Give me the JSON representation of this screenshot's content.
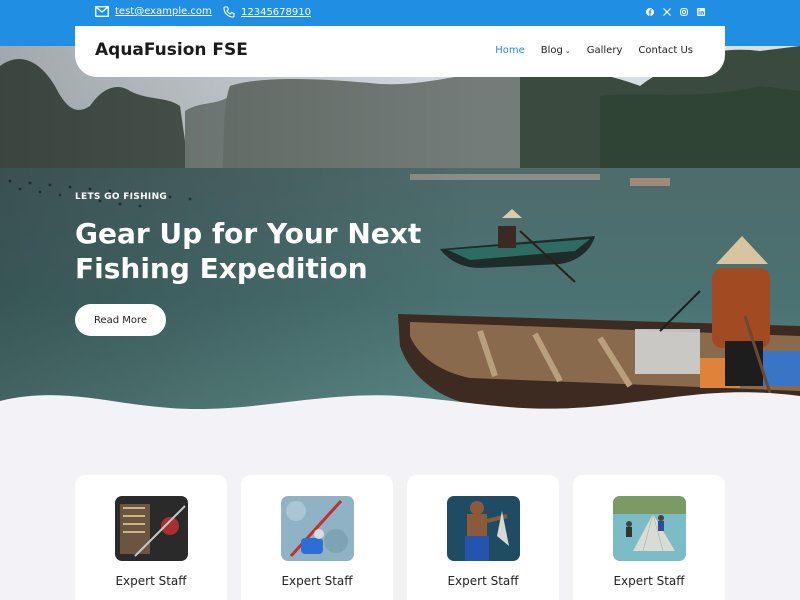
{
  "topbar": {
    "email": "test@example.com",
    "phone": "12345678910",
    "social_icons": [
      "facebook-icon",
      "x-icon",
      "instagram-icon",
      "linkedin-icon"
    ]
  },
  "header": {
    "logo": "AquaFusion FSE",
    "nav": [
      {
        "label": "Home",
        "active": true
      },
      {
        "label": "Blog",
        "dropdown": true
      },
      {
        "label": "Gallery"
      },
      {
        "label": "Contact Us"
      }
    ]
  },
  "hero": {
    "kicker": "LETS GO FISHING",
    "title": "Gear Up for Your Next Fishing Expedition",
    "button_label": "Read More"
  },
  "cards": [
    {
      "title": "Expert Staff"
    },
    {
      "title": "Expert Staff"
    },
    {
      "title": "Expert Staff"
    },
    {
      "title": "Expert Staff"
    }
  ],
  "colors": {
    "accent": "#1f8ee3",
    "background": "#f3f3f7"
  }
}
